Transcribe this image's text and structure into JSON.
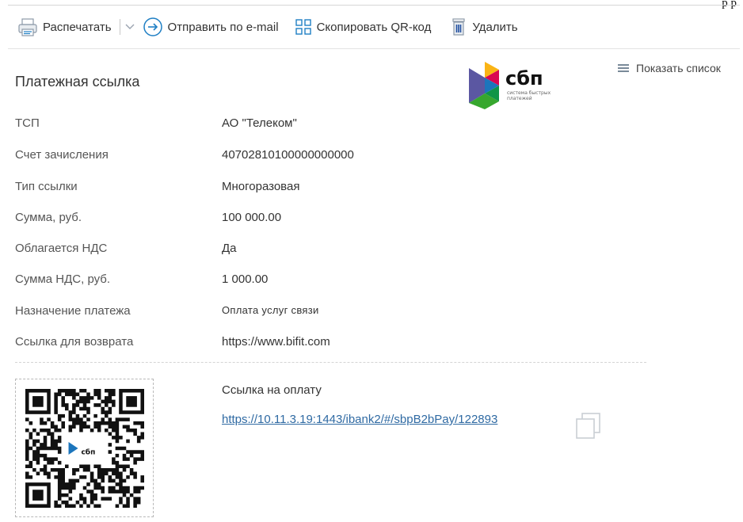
{
  "top_cut_text": "р   р",
  "toolbar": {
    "print_label": "Распечатать",
    "email_label": "Отправить по e-mail",
    "qr_label": "Скопировать QR-код",
    "delete_label": "Удалить"
  },
  "sbp_logo": {
    "text": "сбп",
    "subtitle_line1": "система быстрых",
    "subtitle_line2": "платежей"
  },
  "show_list_label": "Показать список",
  "page_title": "Платежная ссылка",
  "fields": [
    {
      "label": "ТСП",
      "value": "АО \"Телеком\""
    },
    {
      "label": "Счет зачисления",
      "value": "40702810100000000000"
    },
    {
      "label": "Тип ссылки",
      "value": "Многоразовая"
    },
    {
      "label": "Сумма, руб.",
      "value": "100 000.00"
    },
    {
      "label": "Облагается НДС",
      "value": "Да"
    },
    {
      "label": "Сумма НДС, руб.",
      "value": "1 000.00"
    },
    {
      "label": "Назначение платежа",
      "value": "Оплата услуг связи"
    },
    {
      "label": "Ссылка для возврата",
      "value": "https://www.bifit.com"
    }
  ],
  "payment_link": {
    "caption": "Ссылка на оплату",
    "url": "https://10.11.3.19:1443/ibank2/#/sbpB2bPay/122893"
  },
  "qr_logo_text": "сбп",
  "colors": {
    "link": "#2f6aa3",
    "accent_blue": "#1f7fc4",
    "sbp_dark": "#1b2a4a"
  }
}
